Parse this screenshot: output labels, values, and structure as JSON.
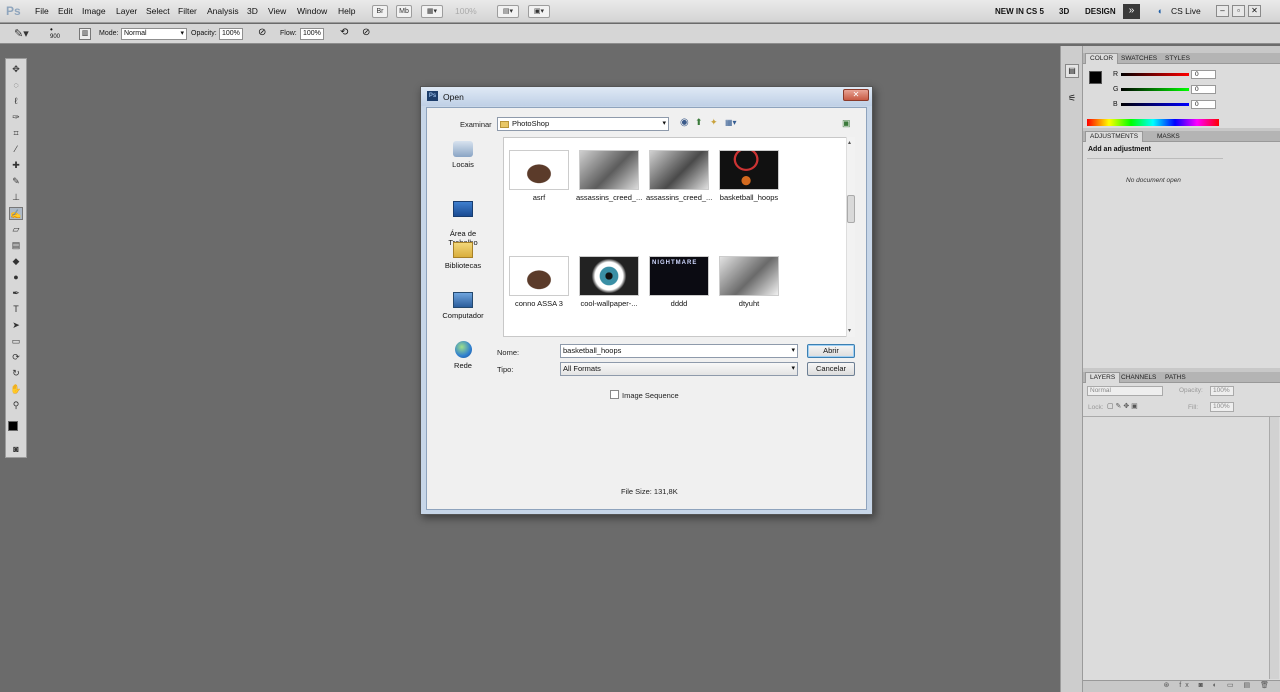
{
  "app": {
    "logo": "Ps"
  },
  "menu": [
    "File",
    "Edit",
    "Image",
    "Layer",
    "Select",
    "Filter",
    "Analysis",
    "3D",
    "View",
    "Window",
    "Help"
  ],
  "menubar_right": {
    "zoom": "100%",
    "new_in_cs5": "NEW IN CS 5",
    "threed": "3D",
    "design": "DESIGN",
    "cslive": "CS Live",
    "more": "»"
  },
  "options": {
    "brush_size": "900",
    "mode_label": "Mode:",
    "mode_value": "Normal",
    "opacity_label": "Opacity:",
    "opacity_value": "100%",
    "flow_label": "Flow:",
    "flow_value": "100%"
  },
  "color_panel": {
    "tabs": [
      "COLOR",
      "SWATCHES",
      "STYLES"
    ],
    "r_label": "R",
    "g_label": "G",
    "b_label": "B",
    "r": "0",
    "g": "0",
    "b": "0"
  },
  "adjustments_panel": {
    "tabs": [
      "ADJUSTMENTS",
      "MASKS"
    ],
    "heading": "Add an adjustment",
    "empty": "No document open"
  },
  "layers_panel": {
    "tabs": [
      "LAYERS",
      "CHANNELS",
      "PATHS"
    ],
    "blend": "Normal",
    "opacity_label": "Opacity:",
    "opacity_value": "100%",
    "lock_label": "Lock:",
    "fill_label": "Fill:",
    "fill_value": "100%"
  },
  "dialog": {
    "title": "Open",
    "look_in_label": "Examinar",
    "look_in_value": "PhotoShop",
    "places": [
      "Locais",
      "Área de\nTrabalho",
      "Bibliotecas",
      "Computador",
      "Rede"
    ],
    "files": [
      {
        "name": "asrf",
        "selected": false
      },
      {
        "name": "assassins_creed_...",
        "selected": false
      },
      {
        "name": "assassins_creed_...",
        "selected": false
      },
      {
        "name": "basketball_hoops",
        "selected": true
      },
      {
        "name": "conno ASSA 3",
        "selected": false
      },
      {
        "name": "cool-wallpaper-...",
        "selected": false
      },
      {
        "name": "dddd",
        "selected": false
      },
      {
        "name": "dtyuht",
        "selected": false
      }
    ],
    "thumb_overlay": {
      "dddd": "NIGHTMARE"
    },
    "name_label": "Nome:",
    "name_value": "basketball_hoops",
    "type_label": "Tipo:",
    "type_value": "All Formats",
    "open_button": "Abrir",
    "cancel_button": "Cancelar",
    "image_sequence": "Image Sequence",
    "file_size": "File Size: 131,8K"
  }
}
